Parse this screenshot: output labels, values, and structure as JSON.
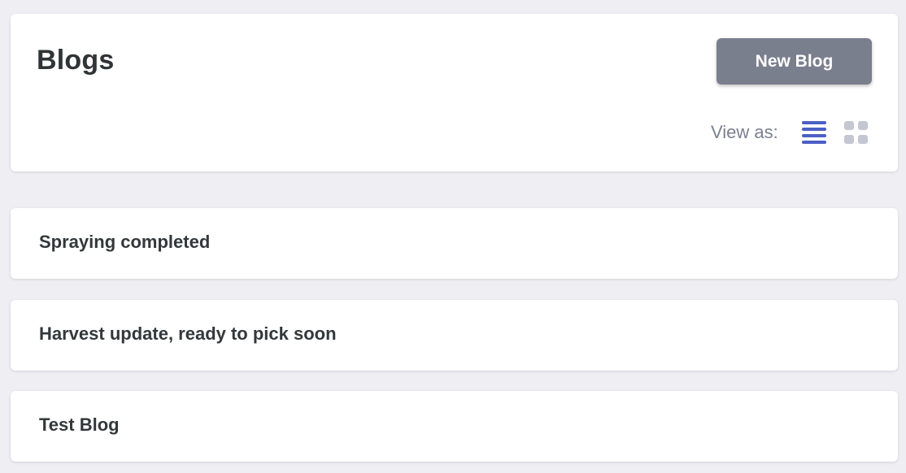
{
  "header": {
    "title": "Blogs",
    "new_blog_label": "New Blog",
    "view_as_label": "View as:",
    "active_view": "list",
    "icons": {
      "list_view": "list-view-icon",
      "grid_view": "grid-view-icon"
    },
    "colors": {
      "active_icon": "#4b5fc4",
      "inactive_icon": "#c4c7d2",
      "button_bg": "#7a7f8e"
    }
  },
  "blogs": [
    {
      "title": "Spraying completed"
    },
    {
      "title": "Harvest update, ready to pick soon"
    },
    {
      "title": "Test Blog"
    }
  ]
}
